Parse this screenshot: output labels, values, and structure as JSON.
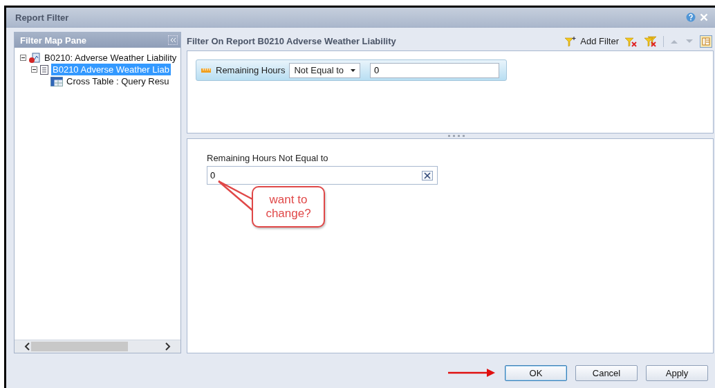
{
  "window": {
    "title": "Report Filter"
  },
  "filter_map_pane": {
    "title": "Filter Map Pane",
    "tree": [
      {
        "label": "B0210: Adverse Weather Liability",
        "kind": "report",
        "expanded": true,
        "selected": false,
        "children": [
          {
            "label": "B0210 Adverse Weather Liab",
            "kind": "document",
            "expanded": true,
            "selected": true,
            "children": [
              {
                "label": "Cross Table : Query Resu",
                "kind": "table",
                "selected": false
              }
            ]
          }
        ]
      }
    ]
  },
  "filter_panel": {
    "title": "Filter On Report B0210 Adverse Weather Liability",
    "add_filter": "Add Filter",
    "filter": {
      "object": "Remaining Hours",
      "operator": "Not Equal to",
      "value": "0"
    }
  },
  "value_panel": {
    "label": "Remaining Hours Not Equal to",
    "value": "0"
  },
  "callout": {
    "text": "want to change?"
  },
  "buttons": [
    {
      "label": "OK",
      "default": true
    },
    {
      "label": "Cancel",
      "default": false
    },
    {
      "label": "Apply",
      "default": false
    }
  ]
}
